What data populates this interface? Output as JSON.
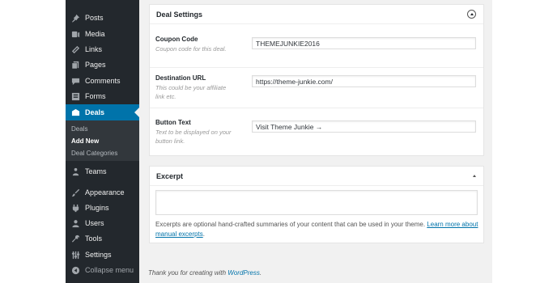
{
  "sidebar": {
    "items": [
      {
        "label": "Posts",
        "icon": "pushpin-icon"
      },
      {
        "label": "Media",
        "icon": "media-icon"
      },
      {
        "label": "Links",
        "icon": "link-icon"
      },
      {
        "label": "Pages",
        "icon": "pages-icon"
      },
      {
        "label": "Comments",
        "icon": "comment-icon"
      },
      {
        "label": "Forms",
        "icon": "forms-icon"
      },
      {
        "label": "Deals",
        "icon": "deals-icon",
        "current": true
      },
      {
        "label": "Teams",
        "icon": "teams-icon"
      },
      {
        "label": "Appearance",
        "icon": "brush-icon"
      },
      {
        "label": "Plugins",
        "icon": "plugin-icon"
      },
      {
        "label": "Users",
        "icon": "users-icon"
      },
      {
        "label": "Tools",
        "icon": "wrench-icon"
      },
      {
        "label": "Settings",
        "icon": "settings-icon"
      },
      {
        "label": "Collapse menu",
        "icon": "collapse-icon"
      }
    ],
    "submenu": [
      {
        "label": "Deals"
      },
      {
        "label": "Add New",
        "current": true
      },
      {
        "label": "Deal Categories"
      }
    ]
  },
  "deal_settings": {
    "title": "Deal Settings",
    "fields": [
      {
        "label": "Coupon Code",
        "desc": "Coupon code for this deal.",
        "value": "THEMEJUNKIE2016"
      },
      {
        "label": "Destination URL",
        "desc": "This could be your affiliate link etc.",
        "value": "https://theme-junkie.com/"
      },
      {
        "label": "Button Text",
        "desc": "Text to be displayed on your button link.",
        "value": "Visit Theme Junkie →"
      }
    ]
  },
  "excerpt": {
    "title": "Excerpt",
    "help_text": "Excerpts are optional hand-crafted summaries of your content that can be used in your theme. ",
    "help_link": "Learn more about manual excerpts",
    "help_end": "."
  },
  "footer": {
    "text": "Thank you for creating with ",
    "link": "WordPress",
    "end": "."
  },
  "colors": {
    "sidebar_bg": "#23282d",
    "submenu_bg": "#32373c",
    "accent": "#0073aa",
    "content_bg": "#f1f1f1"
  }
}
